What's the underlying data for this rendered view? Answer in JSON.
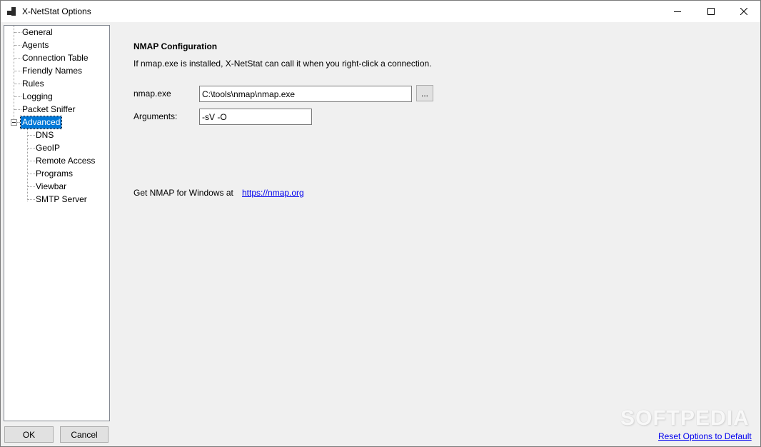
{
  "window": {
    "title": "X-NetStat Options",
    "icon": "app-icon",
    "controls": {
      "minimize": "minimize-icon",
      "maximize": "maximize-icon",
      "close": "close-icon"
    }
  },
  "tree": {
    "items": [
      {
        "label": "General"
      },
      {
        "label": "Agents"
      },
      {
        "label": "Connection Table"
      },
      {
        "label": "Friendly Names"
      },
      {
        "label": "Rules"
      },
      {
        "label": "Logging"
      },
      {
        "label": "Packet Sniffer"
      },
      {
        "label": "Advanced",
        "selected": true,
        "expanded": true,
        "children": [
          {
            "label": "DNS"
          },
          {
            "label": "GeoIP"
          },
          {
            "label": "Remote Access"
          },
          {
            "label": "Programs"
          },
          {
            "label": "Viewbar"
          },
          {
            "label": "SMTP Server"
          }
        ]
      }
    ]
  },
  "footer": {
    "ok_label": "OK",
    "cancel_label": "Cancel",
    "reset_link": "Reset Options to Default"
  },
  "panel": {
    "heading": "NMAP Configuration",
    "description": "If nmap.exe is installed, X-NetStat can call it when you right-click a connection.",
    "nmap_label": "nmap.exe",
    "nmap_value": "C:\\tools\\nmap\\nmap.exe",
    "browse_label": "...",
    "args_label": "Arguments:",
    "args_value": "-sV -O",
    "get_text": "Get NMAP for Windows at",
    "get_link": "https://nmap.org"
  },
  "watermark": "SOFTPEDIA",
  "colors": {
    "selection": "#0078d7",
    "link": "#0000ee",
    "background": "#f0f0f0"
  }
}
